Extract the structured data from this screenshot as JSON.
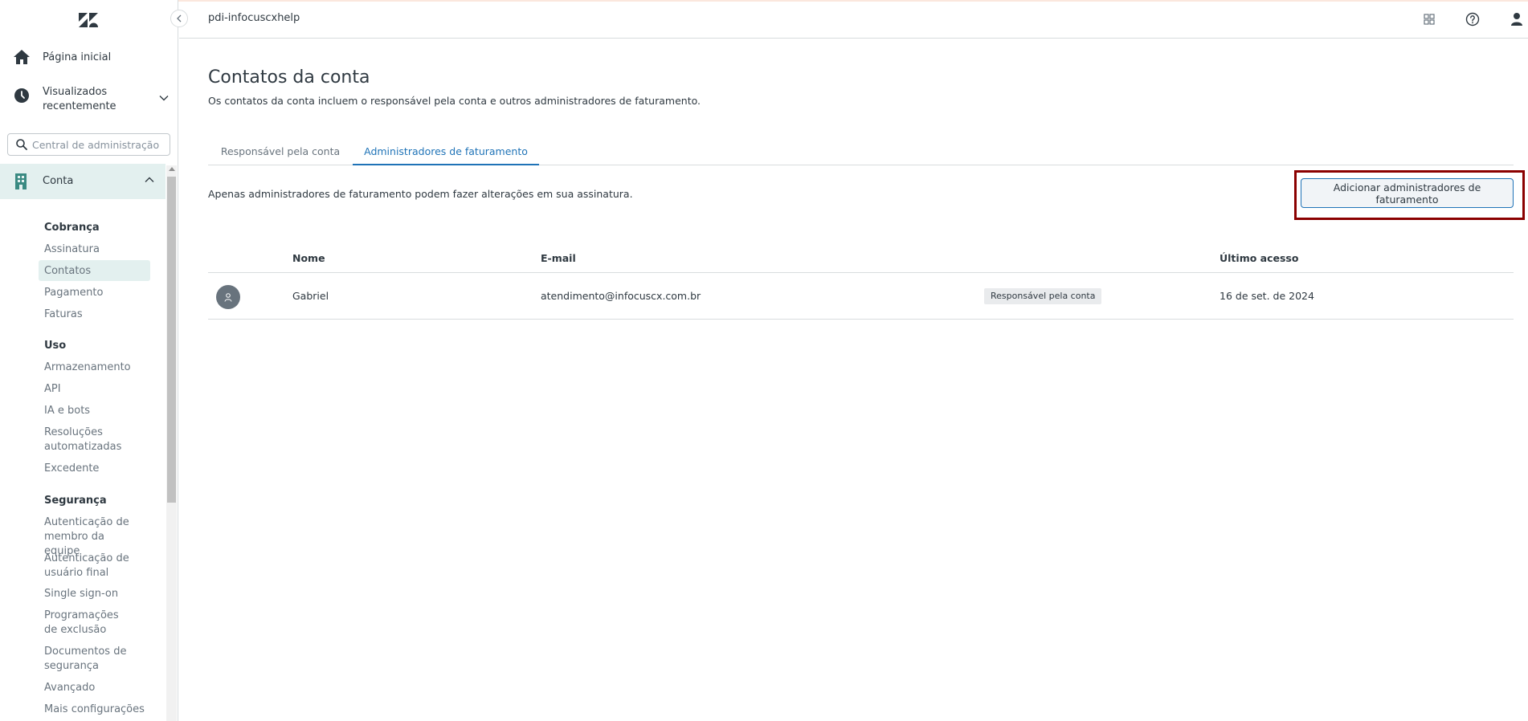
{
  "app": {
    "instance_name": "pdi-infocuscxhelp"
  },
  "sidebar": {
    "home_label": "Página inicial",
    "recent_label": "Visualizados recentemente",
    "search_placeholder": "Central de administração",
    "account_label": "Conta",
    "sections": [
      {
        "heading": "Cobrança",
        "items": [
          "Assinatura",
          "Contatos",
          "Pagamento",
          "Faturas"
        ]
      },
      {
        "heading": "Uso",
        "items": [
          "Armazenamento",
          "API",
          "IA e bots",
          "Resoluções automatizadas",
          "Excedente"
        ]
      },
      {
        "heading": "Segurança",
        "items": [
          "Autenticação de membro da equipe",
          "Autenticação de usuário final",
          "Single sign-on",
          "Programações de exclusão",
          "Documentos de segurança",
          "Avançado",
          "Mais configurações"
        ]
      }
    ],
    "active_item": "Contatos"
  },
  "page": {
    "title": "Contatos da conta",
    "description": "Os contatos da conta incluem o responsável pela conta e outros administradores de faturamento.",
    "tabs": [
      {
        "label": "Responsável pela conta",
        "active": false
      },
      {
        "label": "Administradores de faturamento",
        "active": true
      }
    ],
    "notice": "Apenas administradores de faturamento podem fazer alterações em sua assinatura.",
    "add_button_label": "Adicionar administradores de faturamento"
  },
  "table": {
    "columns": [
      "Nome",
      "E-mail",
      "Último acesso"
    ],
    "rows": [
      {
        "name": "Gabriel",
        "email": "atendimento@infocuscx.com.br",
        "badge": "Responsável pela conta",
        "last_access": "16 de set. de 2024"
      }
    ]
  },
  "icons": {
    "logo": "zendesk-logo",
    "home": "home-icon",
    "recent": "clock-icon",
    "search": "search-icon",
    "account": "building-icon",
    "apps": "grid-icon",
    "help": "help-icon",
    "profile": "user-icon"
  },
  "colors": {
    "accent": "#1f73b7",
    "active_bg": "#e3f0ef",
    "highlight_border": "#8b0000"
  }
}
